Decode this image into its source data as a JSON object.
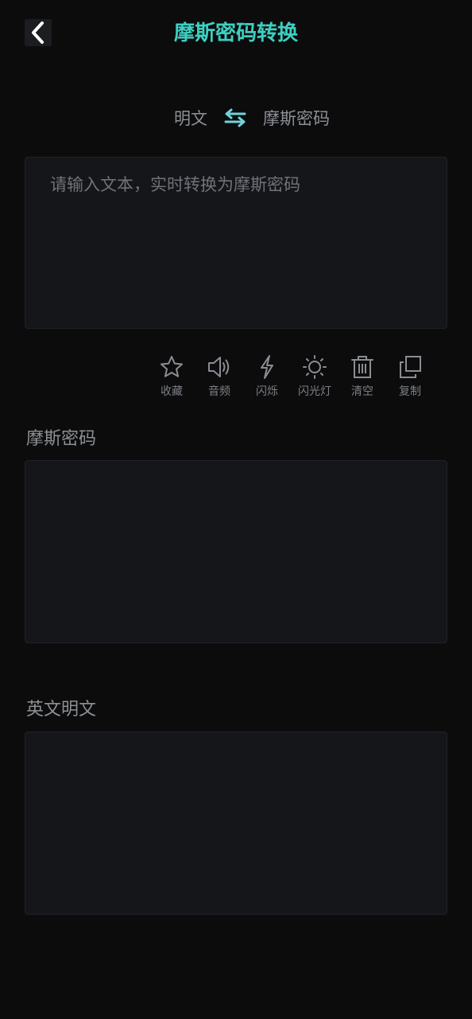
{
  "header": {
    "title": "摩斯密码转换",
    "accent_color": "#3dd0c2",
    "back_icon": "chevron-left-icon"
  },
  "switch": {
    "left_label": "明文",
    "right_label": "摩斯密码",
    "swap_icon": "swap-arrows-icon"
  },
  "input": {
    "placeholder": "请输入文本，实时转换为摩斯密码",
    "value": ""
  },
  "toolbar": {
    "items": [
      {
        "label": "收藏",
        "icon": "star-icon"
      },
      {
        "label": "音频",
        "icon": "speaker-icon"
      },
      {
        "label": "闪烁",
        "icon": "lightning-icon"
      },
      {
        "label": "闪光灯",
        "icon": "sun-icon"
      },
      {
        "label": "清空",
        "icon": "trash-icon"
      },
      {
        "label": "复制",
        "icon": "copy-icon"
      }
    ]
  },
  "morse_output": {
    "label": "摩斯密码",
    "value": ""
  },
  "plain_output": {
    "label": "英文明文",
    "value": ""
  }
}
